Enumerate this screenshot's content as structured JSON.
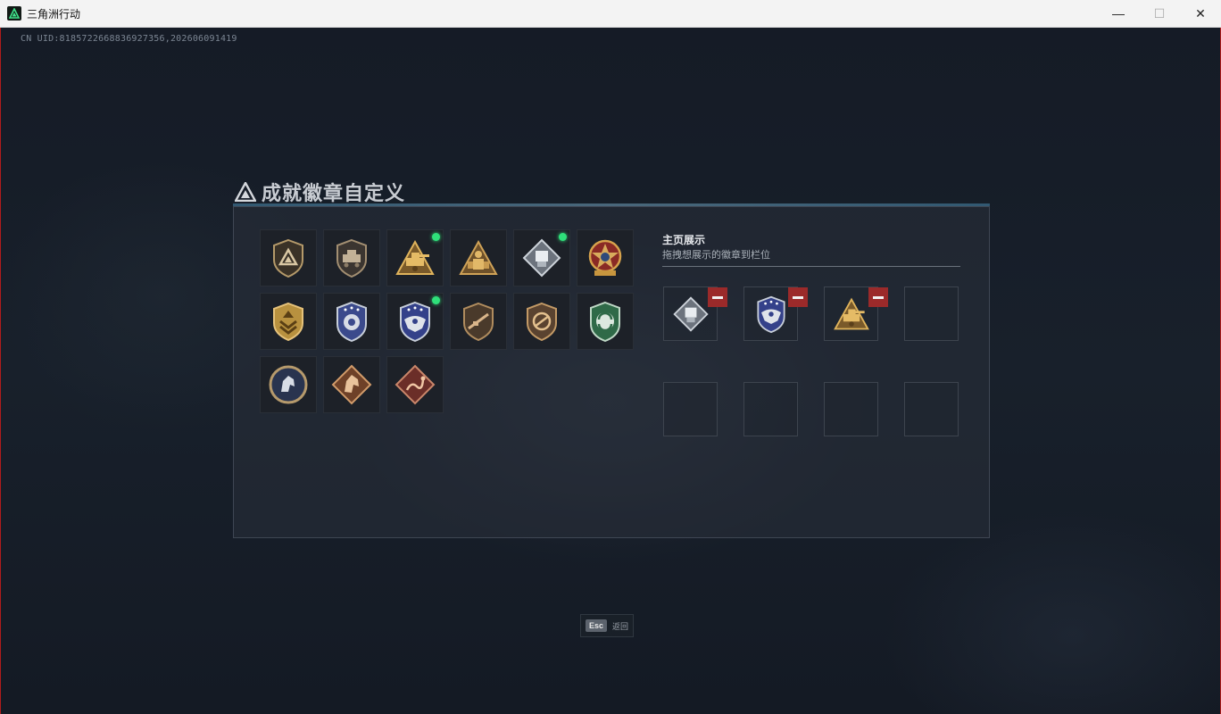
{
  "window": {
    "title": "三角洲行动",
    "controls": {
      "minimize": "—",
      "maximize": "☐",
      "close": "✕"
    }
  },
  "uid_text": "CN UID:8185722668836927356,202606091419",
  "panel": {
    "title": "成就徽章自定义"
  },
  "badges": [
    {
      "icon": "shield-triangle-badge-icon",
      "new": false
    },
    {
      "icon": "shield-vehicle-badge-icon",
      "new": false
    },
    {
      "icon": "gold-tank-triangle-badge-icon",
      "new": true
    },
    {
      "icon": "gold-triangle-soldier-badge-icon",
      "new": false
    },
    {
      "icon": "silver-diamond-badge-icon",
      "new": true
    },
    {
      "icon": "star-medal-badge-icon",
      "new": false
    },
    {
      "icon": "gold-chevron-shield-badge-icon",
      "new": false
    },
    {
      "icon": "blue-police-badge-icon",
      "new": false
    },
    {
      "icon": "blue-eagle-badge-icon",
      "new": true
    },
    {
      "icon": "bronze-rifle-shield-badge-icon",
      "new": false
    },
    {
      "icon": "bronze-no-rifle-shield-badge-icon",
      "new": false
    },
    {
      "icon": "green-arrows-shield-badge-icon",
      "new": false
    },
    {
      "icon": "round-horse-badge-icon",
      "new": false
    },
    {
      "icon": "bronze-horse-diamond-badge-icon",
      "new": false
    },
    {
      "icon": "red-diamond-snake-badge-icon",
      "new": false
    }
  ],
  "display": {
    "title": "主页展示",
    "subtitle": "拖拽想展示的徽章到栏位",
    "slots": [
      {
        "icon": "silver-diamond-badge-icon",
        "filled": true
      },
      {
        "icon": "blue-eagle-badge-icon",
        "filled": true
      },
      {
        "icon": "gold-tank-triangle-badge-icon",
        "filled": true
      },
      {
        "icon": "",
        "filled": false
      },
      {
        "icon": "",
        "filled": false
      },
      {
        "icon": "",
        "filled": false
      },
      {
        "icon": "",
        "filled": false
      },
      {
        "icon": "",
        "filled": false
      }
    ]
  },
  "hint": {
    "key": "Esc",
    "label": "返回"
  }
}
